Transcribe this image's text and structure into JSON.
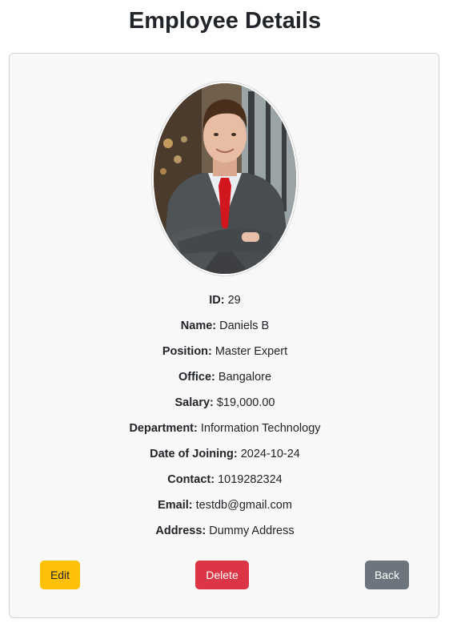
{
  "page": {
    "title": "Employee Details"
  },
  "employee": {
    "photo_alt": "Employee photo",
    "fields": [
      {
        "label": "ID:",
        "value": "29"
      },
      {
        "label": "Name:",
        "value": "Daniels B"
      },
      {
        "label": "Position:",
        "value": "Master Expert"
      },
      {
        "label": "Office:",
        "value": "Bangalore"
      },
      {
        "label": "Salary:",
        "value": "$19,000.00"
      },
      {
        "label": "Department:",
        "value": "Information Technology"
      },
      {
        "label": "Date of Joining:",
        "value": "2024-10-24"
      },
      {
        "label": "Contact:",
        "value": "1019282324"
      },
      {
        "label": "Email:",
        "value": "testdb@gmail.com"
      },
      {
        "label": "Address:",
        "value": "Dummy Address"
      }
    ]
  },
  "actions": {
    "edit_label": "Edit",
    "delete_label": "Delete",
    "back_label": "Back"
  },
  "colors": {
    "edit": "#ffc107",
    "delete": "#dc3545",
    "back": "#6c757d",
    "card_bg": "#f8f8f8"
  }
}
